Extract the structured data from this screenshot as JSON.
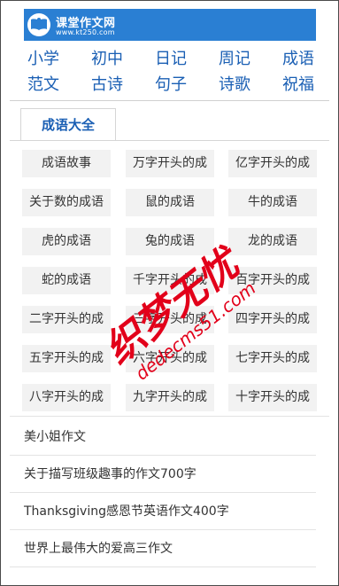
{
  "header": {
    "site_name": "课堂作文网",
    "site_url": "www.kt250.com"
  },
  "nav": {
    "items": [
      "小学",
      "初中",
      "日记",
      "周记",
      "成语",
      "范文",
      "古诗",
      "句子",
      "诗歌",
      "祝福"
    ]
  },
  "tabs": {
    "active_label": "成语大全"
  },
  "grid": {
    "items": [
      "成语故事",
      "万字开头的成",
      "亿字开头的成",
      "关于数的成语",
      "鼠的成语",
      "牛的成语",
      "虎的成语",
      "兔的成语",
      "龙的成语",
      "蛇的成语",
      "千字开头的成",
      "百字开头的成",
      "二字开头的成",
      "三字开头的成",
      "四字开头的成",
      "五字开头的成",
      "六字开头的成",
      "七字开头的成",
      "八字开头的成",
      "九字开头的成",
      "十字开头的成"
    ]
  },
  "articles": {
    "items": [
      "美小姐作文",
      "关于描写班级趣事的作文700字",
      "Thanksgiving感恩节英语作文400字",
      "世界上最伟大的爱高三作文"
    ]
  },
  "watermark": {
    "line1": "织梦无忧",
    "line2": "dedecms51.com"
  },
  "colors": {
    "brand_blue": "#2a7fd3",
    "nav_link": "#1a5fb4",
    "cell_bg": "#f2f2f2",
    "watermark": "#e2001a"
  }
}
